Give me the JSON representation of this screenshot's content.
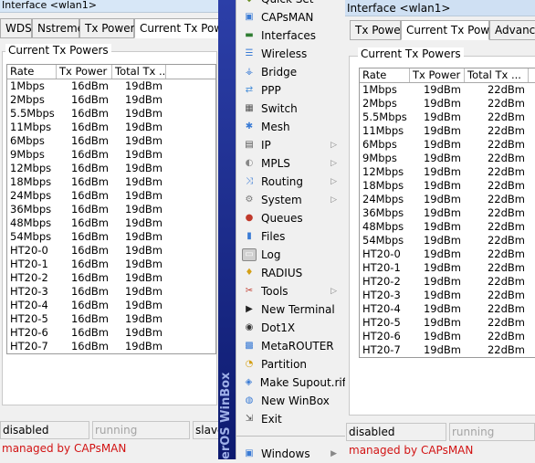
{
  "left_window": {
    "title": "Interface <wlan1>",
    "tabs": [
      "WDS",
      "Nstreme",
      "Tx Power",
      "Current Tx Power"
    ],
    "group_label": "Current Tx Powers",
    "columns": [
      "Rate",
      "Tx Power",
      "Total Tx ..."
    ],
    "rows": [
      [
        "1Mbps",
        "16dBm",
        "19dBm"
      ],
      [
        "2Mbps",
        "16dBm",
        "19dBm"
      ],
      [
        "5.5Mbps",
        "16dBm",
        "19dBm"
      ],
      [
        "11Mbps",
        "16dBm",
        "19dBm"
      ],
      [
        "6Mbps",
        "16dBm",
        "19dBm"
      ],
      [
        "9Mbps",
        "16dBm",
        "19dBm"
      ],
      [
        "12Mbps",
        "16dBm",
        "19dBm"
      ],
      [
        "18Mbps",
        "16dBm",
        "19dBm"
      ],
      [
        "24Mbps",
        "16dBm",
        "19dBm"
      ],
      [
        "36Mbps",
        "16dBm",
        "19dBm"
      ],
      [
        "48Mbps",
        "16dBm",
        "19dBm"
      ],
      [
        "54Mbps",
        "16dBm",
        "19dBm"
      ],
      [
        "HT20-0",
        "16dBm",
        "19dBm"
      ],
      [
        "HT20-1",
        "16dBm",
        "19dBm"
      ],
      [
        "HT20-2",
        "16dBm",
        "19dBm"
      ],
      [
        "HT20-3",
        "16dBm",
        "19dBm"
      ],
      [
        "HT20-4",
        "16dBm",
        "19dBm"
      ],
      [
        "HT20-5",
        "16dBm",
        "19dBm"
      ],
      [
        "HT20-6",
        "16dBm",
        "19dBm"
      ],
      [
        "HT20-7",
        "16dBm",
        "19dBm"
      ]
    ],
    "status": [
      "disabled",
      "running",
      "slave"
    ],
    "managed": "managed by CAPsMAN"
  },
  "menu": {
    "items": [
      {
        "label": "Quick Set",
        "icon": "quick-set-icon",
        "color": "#6b8e23",
        "arrow": false
      },
      {
        "label": "CAPsMAN",
        "icon": "capsman-icon",
        "color": "#3a7bd5",
        "arrow": false
      },
      {
        "label": "Interfaces",
        "icon": "interfaces-icon",
        "color": "#2f7d32",
        "arrow": false
      },
      {
        "label": "Wireless",
        "icon": "wireless-icon",
        "color": "#3a7bd5",
        "arrow": false
      },
      {
        "label": "Bridge",
        "icon": "bridge-icon",
        "color": "#3a7bd5",
        "arrow": false
      },
      {
        "label": "PPP",
        "icon": "ppp-icon",
        "color": "#4a90d9",
        "arrow": false
      },
      {
        "label": "Switch",
        "icon": "switch-icon",
        "color": "#555555",
        "arrow": false
      },
      {
        "label": "Mesh",
        "icon": "mesh-icon",
        "color": "#3a7bd5",
        "arrow": false
      },
      {
        "label": "IP",
        "icon": "ip-icon",
        "color": "#555555",
        "arrow": true
      },
      {
        "label": "MPLS",
        "icon": "mpls-icon",
        "color": "#888888",
        "arrow": true
      },
      {
        "label": "Routing",
        "icon": "routing-icon",
        "color": "#3a7bd5",
        "arrow": true
      },
      {
        "label": "System",
        "icon": "system-gear-icon",
        "color": "#777777",
        "arrow": true
      },
      {
        "label": "Queues",
        "icon": "queues-icon",
        "color": "#c0392b",
        "arrow": false
      },
      {
        "label": "Files",
        "icon": "files-icon",
        "color": "#3a7bd5",
        "arrow": false
      },
      {
        "label": "Log",
        "icon": "log-icon",
        "color": "#ffffff",
        "arrow": false
      },
      {
        "label": "RADIUS",
        "icon": "radius-icon",
        "color": "#d4a017",
        "arrow": false
      },
      {
        "label": "Tools",
        "icon": "tools-icon",
        "color": "#c0392b",
        "arrow": true
      },
      {
        "label": "New Terminal",
        "icon": "terminal-icon",
        "color": "#222222",
        "arrow": false
      },
      {
        "label": "Dot1X",
        "icon": "dot1x-icon",
        "color": "#333333",
        "arrow": false
      },
      {
        "label": "MetaROUTER",
        "icon": "metarouter-icon",
        "color": "#3a7bd5",
        "arrow": false
      },
      {
        "label": "Partition",
        "icon": "partition-icon",
        "color": "#d4a017",
        "arrow": false
      },
      {
        "label": "Make Supout.rif",
        "icon": "supout-icon",
        "color": "#3a7bd5",
        "arrow": false
      },
      {
        "label": "New WinBox",
        "icon": "winbox-icon",
        "color": "#3a7bd5",
        "arrow": false
      },
      {
        "label": "Exit",
        "icon": "exit-icon",
        "color": "#444444",
        "arrow": false
      }
    ],
    "bottom_item": {
      "label": "Windows",
      "icon": "windows-icon",
      "color": "#3a7bd5",
      "arrow": true
    },
    "vertical_text": "erOS WinBox"
  },
  "right_window": {
    "title": "Interface <wlan1>",
    "tabs": [
      "Tx Power",
      "Current Tx Power",
      "Advance"
    ],
    "group_label": "Current Tx Powers",
    "columns": [
      "Rate",
      "Tx Power",
      "Total Tx ..."
    ],
    "rows": [
      [
        "1Mbps",
        "19dBm",
        "22dBm"
      ],
      [
        "2Mbps",
        "19dBm",
        "22dBm"
      ],
      [
        "5.5Mbps",
        "19dBm",
        "22dBm"
      ],
      [
        "11Mbps",
        "19dBm",
        "22dBm"
      ],
      [
        "6Mbps",
        "19dBm",
        "22dBm"
      ],
      [
        "9Mbps",
        "19dBm",
        "22dBm"
      ],
      [
        "12Mbps",
        "19dBm",
        "22dBm"
      ],
      [
        "18Mbps",
        "19dBm",
        "22dBm"
      ],
      [
        "24Mbps",
        "19dBm",
        "22dBm"
      ],
      [
        "36Mbps",
        "19dBm",
        "22dBm"
      ],
      [
        "48Mbps",
        "19dBm",
        "22dBm"
      ],
      [
        "54Mbps",
        "19dBm",
        "22dBm"
      ],
      [
        "HT20-0",
        "19dBm",
        "22dBm"
      ],
      [
        "HT20-1",
        "19dBm",
        "22dBm"
      ],
      [
        "HT20-2",
        "19dBm",
        "22dBm"
      ],
      [
        "HT20-3",
        "19dBm",
        "22dBm"
      ],
      [
        "HT20-4",
        "19dBm",
        "22dBm"
      ],
      [
        "HT20-5",
        "19dBm",
        "22dBm"
      ],
      [
        "HT20-6",
        "19dBm",
        "22dBm"
      ],
      [
        "HT20-7",
        "19dBm",
        "22dBm"
      ]
    ],
    "status": [
      "disabled",
      "running"
    ],
    "managed": "managed by CAPsMAN"
  }
}
